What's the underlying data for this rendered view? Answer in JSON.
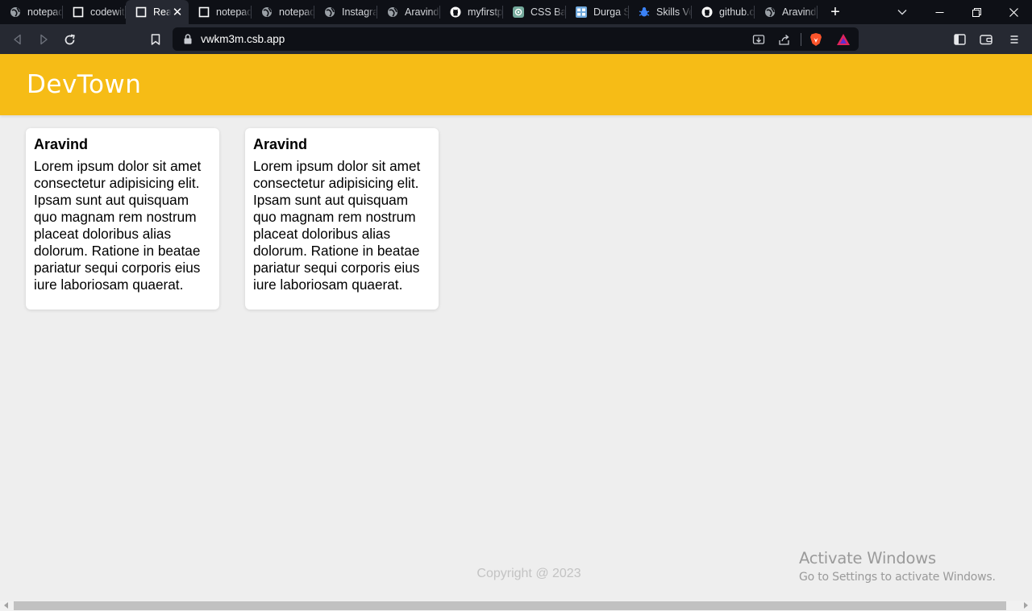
{
  "browser": {
    "tabs": [
      {
        "title": "notepad",
        "icon": "globe-icon"
      },
      {
        "title": "codewith",
        "icon": "codesandbox-icon"
      },
      {
        "title": "React",
        "icon": "codesandbox-icon",
        "active": true
      },
      {
        "title": "notepad",
        "icon": "codesandbox-icon"
      },
      {
        "title": "notepad",
        "icon": "globe-icon"
      },
      {
        "title": "Instagram",
        "icon": "globe-icon"
      },
      {
        "title": "Aravind",
        "icon": "globe-icon"
      },
      {
        "title": "myfirstp",
        "icon": "github-icon"
      },
      {
        "title": "CSS Back",
        "icon": "chatgpt-icon"
      },
      {
        "title": "Durga S",
        "icon": "repo-icon"
      },
      {
        "title": "Skills Ve",
        "icon": "bug-icon"
      },
      {
        "title": "github.c",
        "icon": "github-icon"
      },
      {
        "title": "Aravind",
        "icon": "globe-icon"
      }
    ],
    "close_glyph": "✕",
    "new_tab_glyph": "+",
    "url": "vwkm3m.csb.app"
  },
  "app": {
    "brand": "DevTown",
    "cards": [
      {
        "name": "Aravind",
        "body": "Lorem ipsum dolor sit amet consectetur adipisicing elit. Ipsam sunt aut quisquam quo magnam rem nostrum placeat doloribus alias dolorum. Ratione in beatae pariatur sequi corporis eius iure laboriosam quaerat."
      },
      {
        "name": "Aravind",
        "body": "Lorem ipsum dolor sit amet consectetur adipisicing elit. Ipsam sunt aut quisquam quo magnam rem nostrum placeat doloribus alias dolorum. Ratione in beatae pariatur sequi corporis eius iure laboriosam quaerat."
      }
    ],
    "footer": "Copyright @ 2023"
  },
  "os_overlay": {
    "title": "Activate Windows",
    "subtitle": "Go to Settings to activate Windows."
  },
  "colors": {
    "navbar": "#f6bc16",
    "page_bg": "#eeeeee",
    "card_bg": "#ffffff",
    "tabstrip_bg": "#0e1016",
    "toolbar_bg": "#262932"
  }
}
